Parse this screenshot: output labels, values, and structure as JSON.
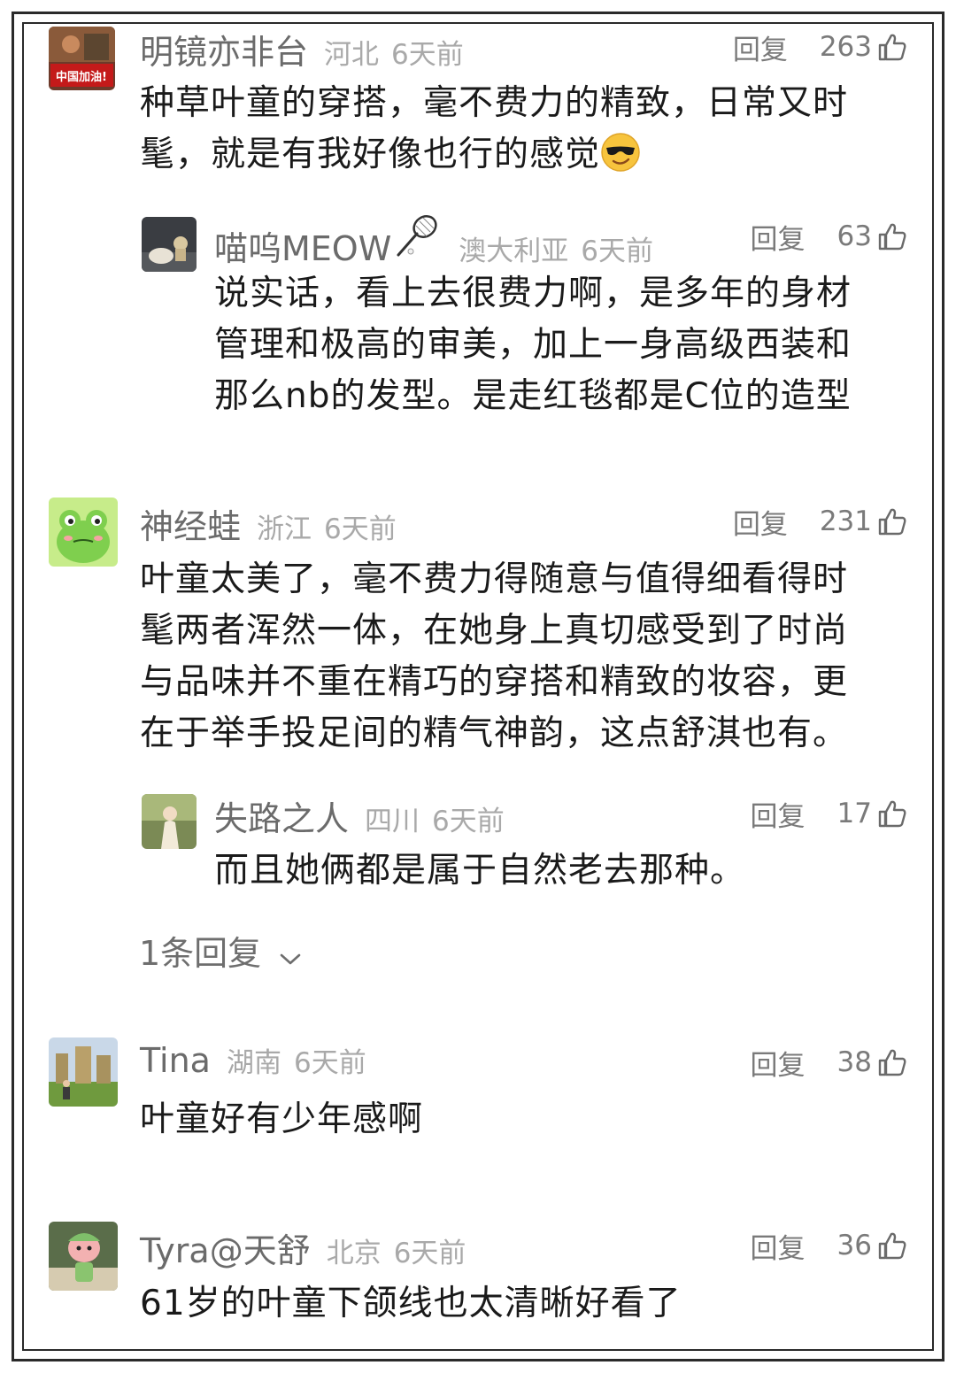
{
  "reply_label": "回复",
  "expand_label": "1条回复",
  "comments": [
    {
      "username": "明镜亦非台",
      "location": "河北",
      "time": "6天前",
      "likes": "263",
      "avatar_text": "中国加油!",
      "text_lines": [
        "种草叶童的穿搭，毫不费力的精致，日常又时",
        "髦，就是有我好像也行的感觉"
      ],
      "emoji": "smiling-face-with-sunglasses",
      "replies": [
        {
          "username": "喵呜MEOW",
          "location": "澳大利亚",
          "time": "6天前",
          "likes": "63",
          "badge_icon": "badminton-racket",
          "text_lines": [
            "说实话，看上去很费力啊，是多年的身材",
            "管理和极高的审美，加上一身高级西装和",
            "那么nb的发型。是走红毯都是C位的造型"
          ]
        }
      ]
    },
    {
      "username": "神经蛙",
      "location": "浙江",
      "time": "6天前",
      "likes": "231",
      "text_lines": [
        "叶童太美了，毫不费力得随意与值得细看得时",
        "髦两者浑然一体，在她身上真切感受到了时尚",
        "与品味并不重在精巧的穿搭和精致的妆容，更",
        "在于举手投足间的精气神韵，这点舒淇也有。"
      ],
      "replies": [
        {
          "username": "失路之人",
          "location": "四川",
          "time": "6天前",
          "likes": "17",
          "text_lines": [
            "而且她俩都是属于自然老去那种。"
          ]
        }
      ]
    },
    {
      "username": "Tina",
      "location": "湖南",
      "time": "6天前",
      "likes": "38",
      "text_lines": [
        "叶童好有少年感啊"
      ]
    },
    {
      "username": "Tyra@天舒",
      "location": "北京",
      "time": "6天前",
      "likes": "36",
      "text_lines": [
        "61岁的叶童下颌线也太清晰好看了"
      ]
    }
  ]
}
